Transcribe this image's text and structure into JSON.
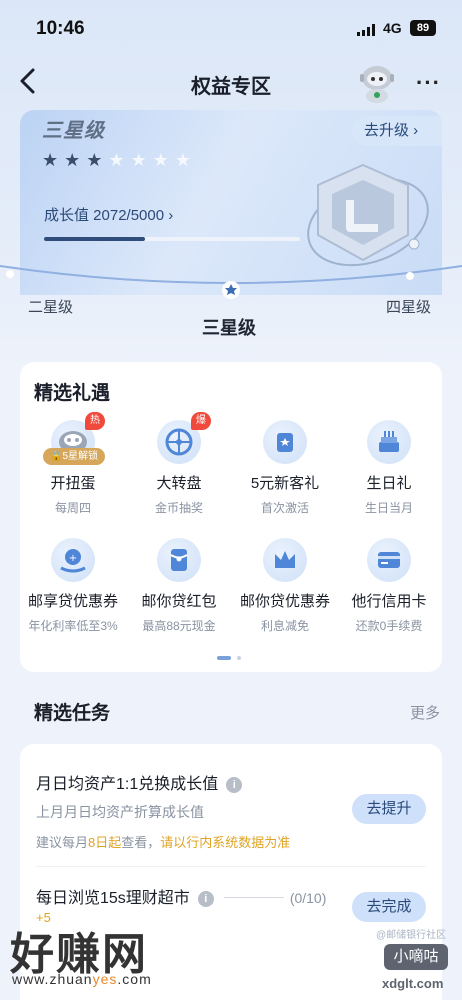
{
  "status_bar": {
    "time": "10:46",
    "network": "4G",
    "battery": "89"
  },
  "nav": {
    "title": "权益专区",
    "more_label": "···"
  },
  "hero": {
    "level_name": "三星级",
    "stars_filled": 3,
    "stars_total": 7,
    "growth_text": "成长值 2072/5000 ›",
    "growth_current": 2072,
    "growth_target": 5000,
    "upgrade_label": "去升级 ›"
  },
  "levels": {
    "prev": "二星级",
    "current": "三星级",
    "next": "四星级"
  },
  "gifts": {
    "title": "精选礼遇",
    "items": [
      {
        "name": "开扭蛋",
        "sub": "每周四",
        "tag": "热",
        "lock": "5星解锁",
        "icon": "capsule-machine-icon"
      },
      {
        "name": "大转盘",
        "sub": "金币抽奖",
        "tag": "爆",
        "icon": "wheel-icon"
      },
      {
        "name": "5元新客礼",
        "sub": "首次激活",
        "icon": "gift-bag-icon"
      },
      {
        "name": "生日礼",
        "sub": "生日当月",
        "icon": "birthday-cake-icon"
      },
      {
        "name": "邮享贷优惠券",
        "sub": "年化利率低至3%",
        "icon": "loan-coupon-icon"
      },
      {
        "name": "邮你贷红包",
        "sub": "最高88元现金",
        "icon": "red-packet-icon"
      },
      {
        "name": "邮你贷优惠券",
        "sub": "利息减免",
        "icon": "crown-icon"
      },
      {
        "name": "他行信用卡",
        "sub": "还款0手续费",
        "icon": "credit-card-icon"
      }
    ]
  },
  "tasks": {
    "title": "精选任务",
    "more_label": "更多",
    "items": [
      {
        "title": "月日均资产1:1兑换成长值",
        "sub": "上月月日均资产折算成长值",
        "tip_prefix": "建议每月",
        "tip_highlight1": "8日起",
        "tip_mid": "查看，",
        "tip_highlight2": "请以行内系统数据为准",
        "button": "去提升"
      },
      {
        "title": "每日浏览15s理财超市",
        "progress": "(0/10)",
        "reward": "+5",
        "button": "去完成"
      }
    ]
  },
  "watermark": {
    "brand": "好赚网",
    "url_a": "www.zhuan",
    "url_b": "yes",
    "url_c": ".com",
    "badge": "小嘀咕",
    "community": "@邮储银行社区",
    "site": "xdglt.com"
  },
  "colors": {
    "accent": "#2a4a7a",
    "hot_tag": "#f04a3c",
    "highlight": "#e0a424"
  }
}
